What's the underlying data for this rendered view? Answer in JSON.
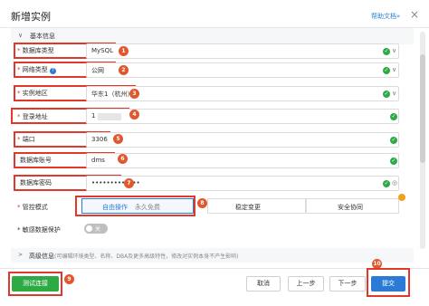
{
  "dialog": {
    "title": "新增实例",
    "help": "帮助文档»",
    "close": "×"
  },
  "section": {
    "title": "基本信息",
    "chevron": "∨"
  },
  "fields": {
    "db_type": {
      "label": "数据库类型",
      "value": "MySQL",
      "badge": "1"
    },
    "net_type": {
      "label": "网络类型",
      "value": "公网",
      "badge": "2"
    },
    "region": {
      "label": "实例地区",
      "value": "华东1（杭州）",
      "badge": "3"
    },
    "address": {
      "label": "登录地址",
      "value": "1",
      "badge": "4"
    },
    "port": {
      "label": "端口",
      "value": "3306",
      "badge": "5"
    },
    "account": {
      "label": "数据库账号",
      "value": "dms",
      "badge": "6"
    },
    "password": {
      "label": "数据库密码",
      "value": "•••••••••••••",
      "badge": "7"
    }
  },
  "control_mode": {
    "label": "管控模式",
    "options": [
      "自由操作",
      "永久免费",
      "稳定变更",
      "安全协同"
    ],
    "badge": "8"
  },
  "sensitive": {
    "label": "敏感数据保护",
    "toggle": "关"
  },
  "advanced": {
    "title": "高级信息",
    "desc": "(可编辑环境类型、名称、DBA及更多高级特性，修改对实例本身不产生影响)"
  },
  "buttons": {
    "test": "测试连接",
    "cancel": "取消",
    "prev": "上一步",
    "next": "下一步",
    "submit": "提交"
  },
  "badges": {
    "test": "9",
    "submit": "10"
  },
  "icons": {
    "check": "✓",
    "chevron_down": "∨",
    "eye": "◎",
    "help": "?"
  },
  "colors": {
    "accent": "#2b7bd6",
    "success": "#2eaa44",
    "highlight": "#e0392b",
    "badge": "#e2582e"
  }
}
